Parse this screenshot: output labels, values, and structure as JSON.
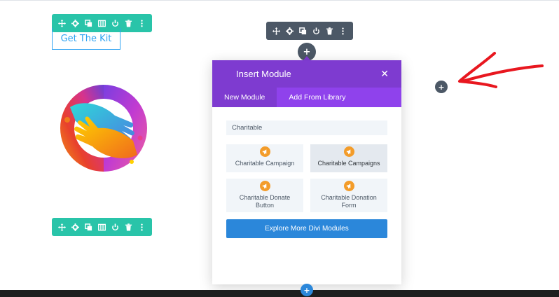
{
  "left_column": {
    "button_label": "Get The Kit"
  },
  "toolbar_icons": [
    "move-icon",
    "settings-icon",
    "duplicate-icon",
    "columns-icon",
    "save-icon",
    "delete-icon",
    "more-icon"
  ],
  "add_symbol": "+",
  "modal": {
    "title": "Insert Module",
    "close_symbol": "✕",
    "tabs": [
      {
        "label": "New Module",
        "active": true
      },
      {
        "label": "Add From Library",
        "active": false
      }
    ],
    "search_value": "Charitable",
    "modules": [
      {
        "label": "Charitable Campaign",
        "icon": "megaphone-icon"
      },
      {
        "label": "Charitable Campaigns",
        "icon": "megaphone-icon"
      },
      {
        "label": "Charitable Donate Button",
        "icon": "megaphone-icon"
      },
      {
        "label": "Charitable Donation Form",
        "icon": "megaphone-icon"
      }
    ],
    "explore_label": "Explore More Divi Modules"
  },
  "colors": {
    "green_toolbar": "#29c4a9",
    "gray_toolbar": "#4c5866",
    "modal_header": "#7e3bd0",
    "modal_tabs": "#8f42ec",
    "primary_blue": "#2b87da",
    "module_icon": "#f39c2a",
    "arrow": "#e8171f"
  }
}
